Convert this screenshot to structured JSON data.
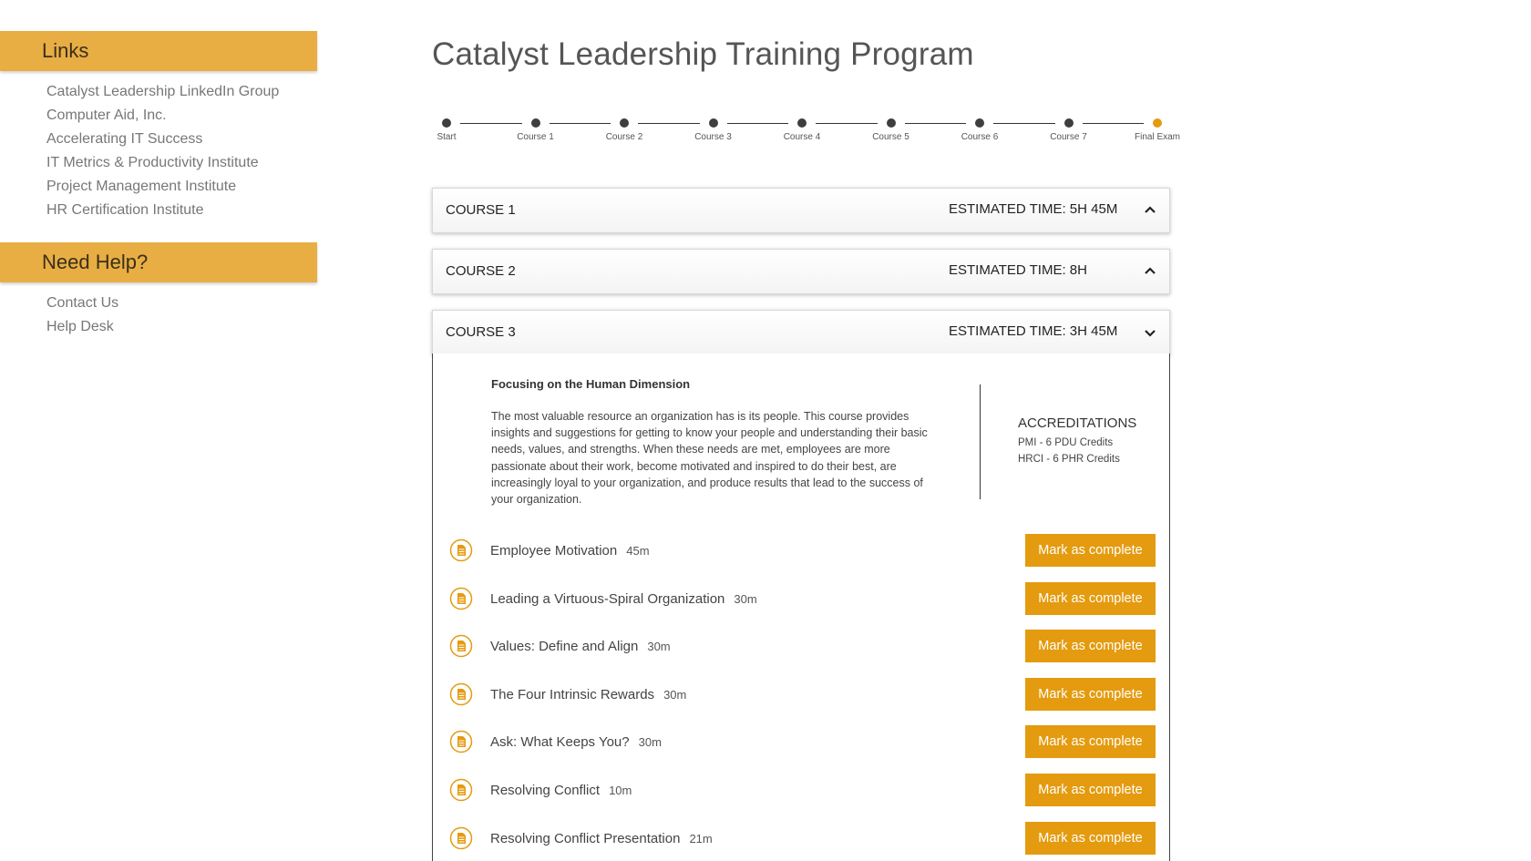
{
  "sidebar": {
    "links_title": "Links",
    "links": [
      "Catalyst Leadership LinkedIn Group",
      "Computer Aid, Inc.",
      "Accelerating IT Success",
      "IT Metrics & Productivity Institute",
      "Project Management Institute",
      "HR Certification Institute"
    ],
    "help_title": "Need Help?",
    "help_links": [
      "Contact Us",
      "Help Desk"
    ]
  },
  "page_title": "Catalyst Leadership Training Program",
  "progress": {
    "steps": [
      "Start",
      "Course 1",
      "Course 2",
      "Course 3",
      "Course 4",
      "Course 5",
      "Course 6",
      "Course 7",
      "Final Exam"
    ],
    "active_index": 8,
    "colors": {
      "dot": "#3e3e3e",
      "active": "#e49b0f"
    }
  },
  "courses": [
    {
      "name": "COURSE 1",
      "time": "ESTIMATED TIME: 5H 45M",
      "expanded": false
    },
    {
      "name": "COURSE 2",
      "time": "ESTIMATED TIME: 8H",
      "expanded": false
    },
    {
      "name": "COURSE 3",
      "time": "ESTIMATED TIME: 3H 45M",
      "expanded": true
    }
  ],
  "course3": {
    "desc_title": "Focusing on the Human Dimension",
    "desc_text": "The most valuable resource an organization has is its people. This course provides insights and suggestions for getting to know your people and understanding their basic needs, values, and strengths. When these needs are met, employees are more passionate about their work, become motivated and inspired to do their best, are increasingly loyal to your organization, and produce results that lead to the success of your organization.",
    "accreditations_title": "ACCREDITATIONS",
    "accreditations": [
      "PMI - 6 PDU Credits",
      "HRCI - 6 PHR Credits"
    ],
    "lessons": [
      {
        "title": "Employee Motivation",
        "duration": "45m"
      },
      {
        "title": "Leading a Virtuous-Spiral Organization",
        "duration": "30m"
      },
      {
        "title": "Values: Define and Align",
        "duration": "30m"
      },
      {
        "title": "The Four Intrinsic Rewards",
        "duration": "30m"
      },
      {
        "title": "Ask: What Keeps You?",
        "duration": "30m"
      },
      {
        "title": "Resolving Conflict",
        "duration": "10m"
      },
      {
        "title": "Resolving Conflict Presentation",
        "duration": "21m"
      }
    ],
    "mark_label": "Mark as complete",
    "lesson_icon": "document-icon"
  },
  "colors": {
    "accent": "#e49b0f",
    "sidebar_header": "#e8ae44"
  }
}
